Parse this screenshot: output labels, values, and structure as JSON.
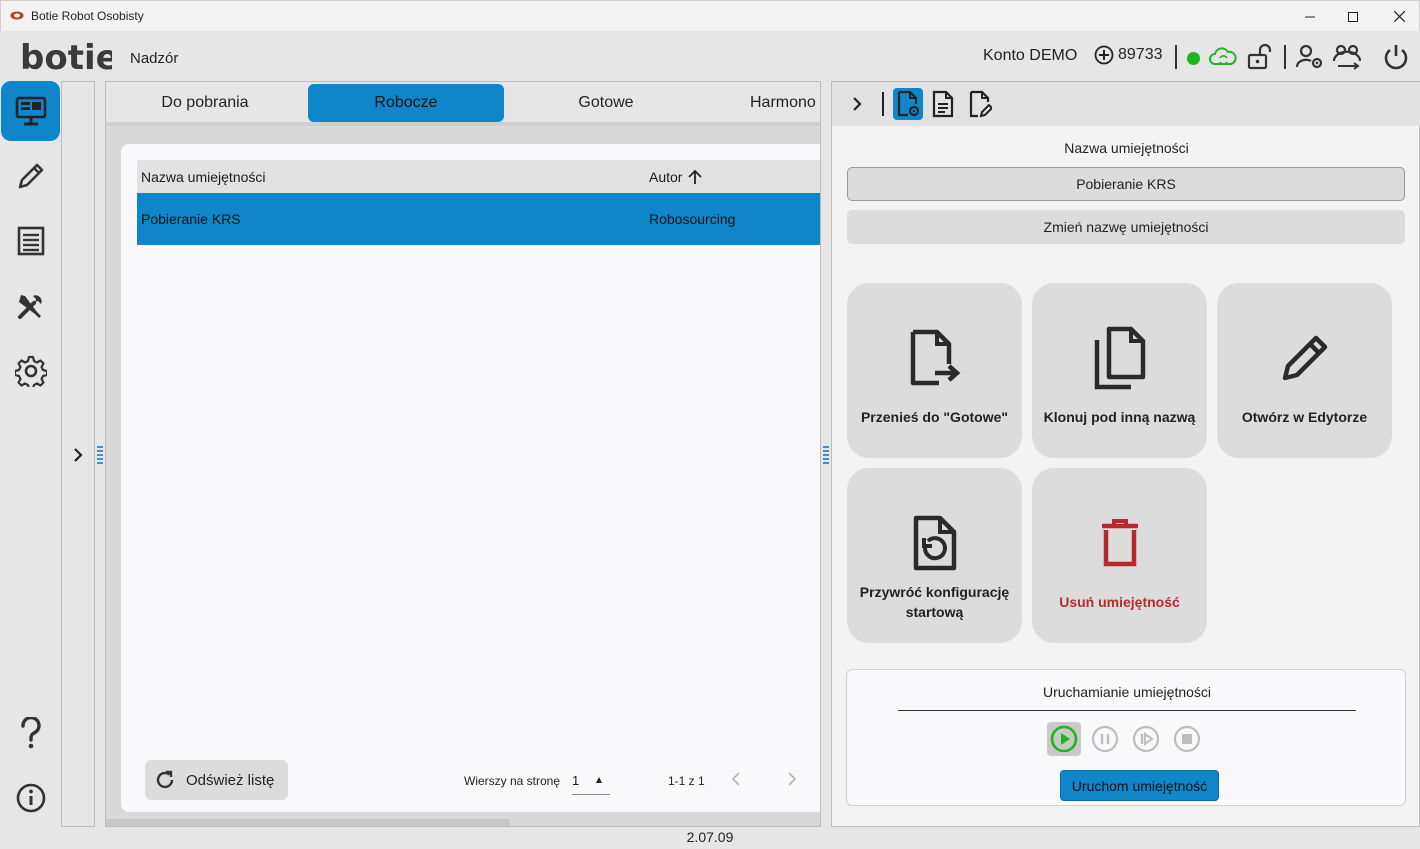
{
  "window": {
    "title": "Botie Robot Osobisty"
  },
  "header": {
    "logo": "botie",
    "nav_label": "Nadzór",
    "account": "Konto DEMO",
    "credits": "89733",
    "connection_status": "online"
  },
  "sidebar": {
    "items": [
      {
        "name": "monitor-icon",
        "active": true
      },
      {
        "name": "pencil-icon",
        "active": false
      },
      {
        "name": "list-icon",
        "active": false
      },
      {
        "name": "tools-icon",
        "active": false
      },
      {
        "name": "gear-icon",
        "active": false
      },
      {
        "name": "help-icon",
        "active": false
      },
      {
        "name": "info-icon",
        "active": false
      }
    ]
  },
  "tabs": [
    {
      "label": "Do pobrania",
      "active": false
    },
    {
      "label": "Robocze",
      "active": true
    },
    {
      "label": "Gotowe",
      "active": false
    },
    {
      "label": "Harmono",
      "active": false
    }
  ],
  "table": {
    "columns": [
      "Nazwa umiejętności",
      "Autor"
    ],
    "sort": {
      "column": "Autor",
      "direction": "ascending"
    },
    "rows": [
      {
        "name": "Pobieranie KRS",
        "author": "Robosourcing",
        "selected": true
      }
    ]
  },
  "footer_controls": {
    "refresh_label": "Odśwież listę",
    "rows_per_page_label": "Wierszy na stronę",
    "rows_per_page_value": "1",
    "range": "1-1 z 1"
  },
  "details": {
    "field_label": "Nazwa umiejętności",
    "field_value": "Pobieranie KRS",
    "rename_label": "Zmień nazwę umiejętności",
    "actions": [
      {
        "label": "Przenieś do \"Gotowe\"",
        "icon": "file-move-icon"
      },
      {
        "label": "Klonuj pod inną nazwą",
        "icon": "copy-icon"
      },
      {
        "label": "Otwórz w Edytorze",
        "icon": "pencil-icon"
      },
      {
        "label": "Przywróć konfigurację startową",
        "icon": "file-restore-icon"
      },
      {
        "label": "Usuń umiejętność",
        "icon": "trash-icon",
        "color": "#b52b2b"
      }
    ],
    "run": {
      "title": "Uruchamianie umiejętności",
      "button_label": "Uruchom umiejętność"
    }
  },
  "version": "2.07.09",
  "colors": {
    "accent": "#0e86c9",
    "danger": "#b52b2b",
    "success": "#1fb51f"
  }
}
